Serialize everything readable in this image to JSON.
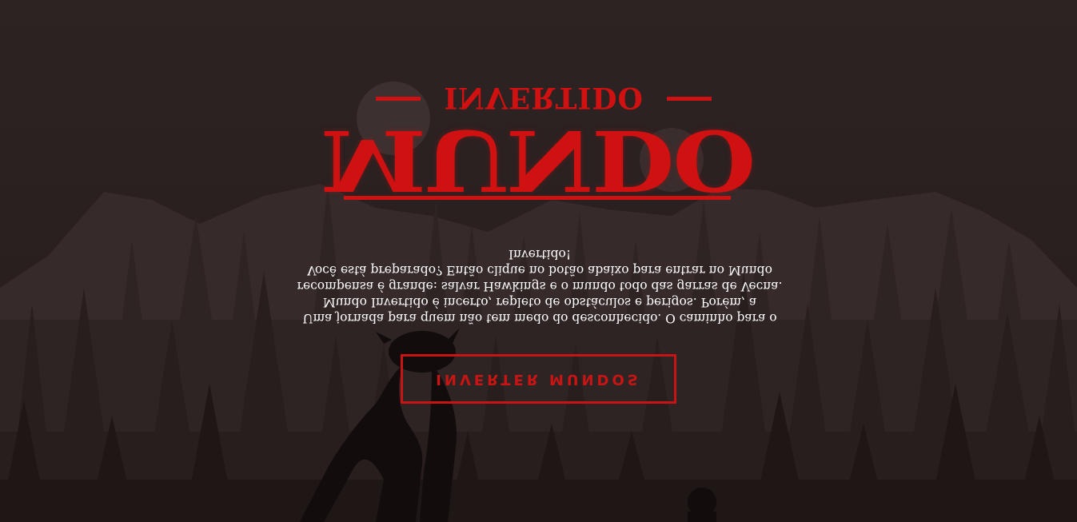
{
  "hero": {
    "title": "MUNDO",
    "subtitle": "INVERTIDO",
    "description": "Uma jornada para quem não tem medo do desconhecido. O caminho para o Mundo Invertido é incerto, repleto de obstáculos e perigos. Porém, a recompensa é grande: salvar Hawkings e o mundo todo das garras de Vecna. Você está preparado? Então clique no botão abaixo para entrar no Mundo Invertido!",
    "cta_label": "INVERTER MUNDOS"
  },
  "colors": {
    "accent": "#cf1111",
    "background": "#2b2020",
    "text": "#ffffff"
  }
}
